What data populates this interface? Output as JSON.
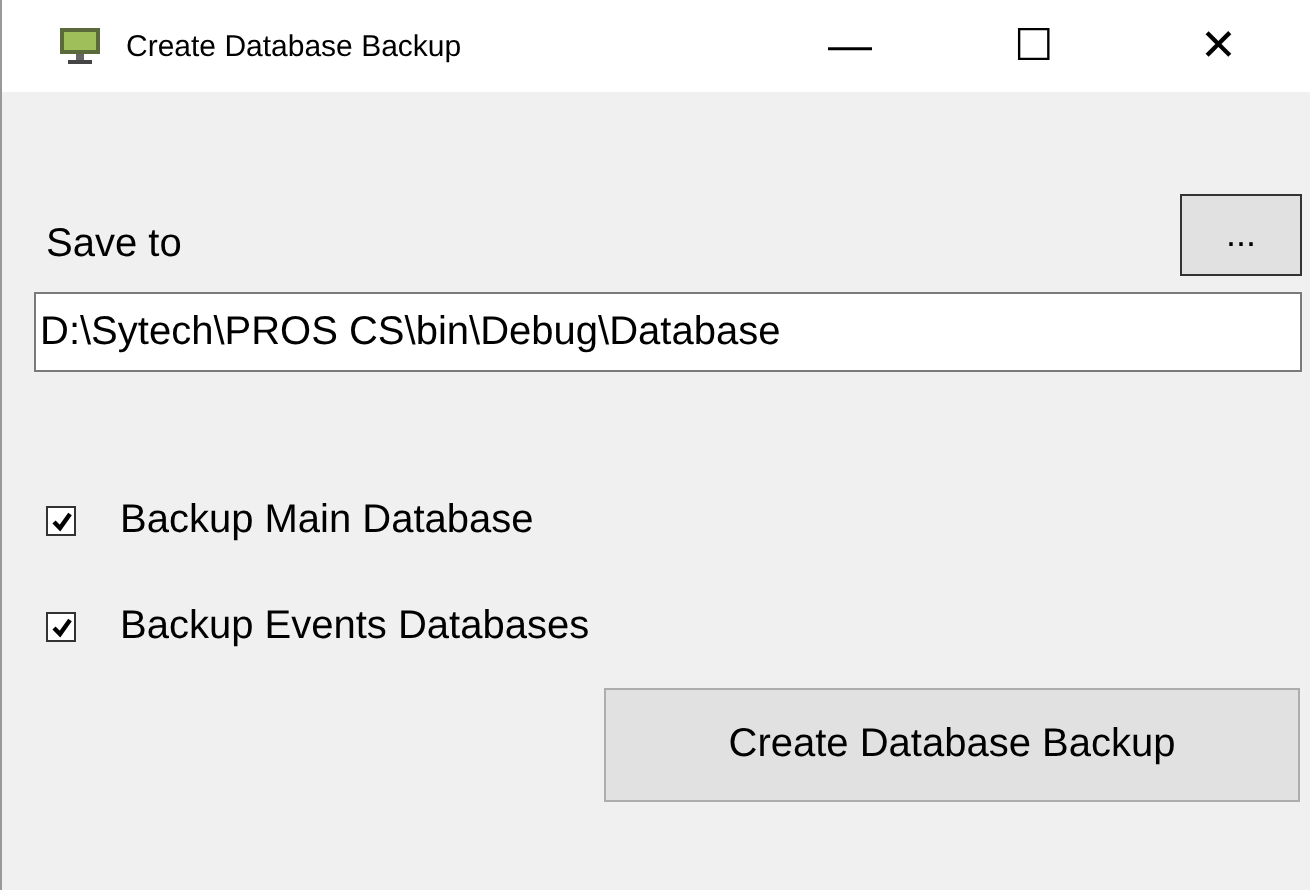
{
  "window": {
    "title": "Create Database Backup",
    "controls": [
      "—",
      "☐",
      "✕"
    ]
  },
  "save_to": {
    "label": "Save to",
    "browse_button": "...",
    "value": "D:\\Sytech\\PROS CS\\bin\\Debug\\Database"
  },
  "options": [
    {
      "label": "Backup Main Database",
      "checked": true
    },
    {
      "label": "Backup Events Databases",
      "checked": true
    }
  ],
  "buttons": [
    "Create Database Backup"
  ]
}
